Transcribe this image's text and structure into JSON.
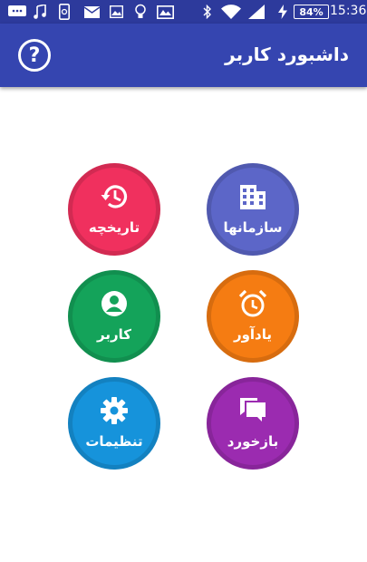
{
  "status_bar": {
    "battery": "84%",
    "time": "15:36",
    "bg_color": "#2d3a9c"
  },
  "app_bar": {
    "title": "داشبورد کاربر",
    "help_icon": "question-circle-icon",
    "bg_color": "#3545b0"
  },
  "tiles": [
    {
      "label": "سازمانها",
      "icon": "building-icon",
      "color": "#5c66c8"
    },
    {
      "label": "تاریخچه",
      "icon": "history-icon",
      "color": "#f0305e"
    },
    {
      "label": "یادآور",
      "icon": "alarm-clock-icon",
      "color": "#f57c12"
    },
    {
      "label": "کاربر",
      "icon": "user-icon",
      "color": "#14a35a"
    },
    {
      "label": "بازخورد",
      "icon": "chat-icon",
      "color": "#9b2bb0"
    },
    {
      "label": "تنظیمات",
      "icon": "gear-icon",
      "color": "#1693db"
    }
  ]
}
